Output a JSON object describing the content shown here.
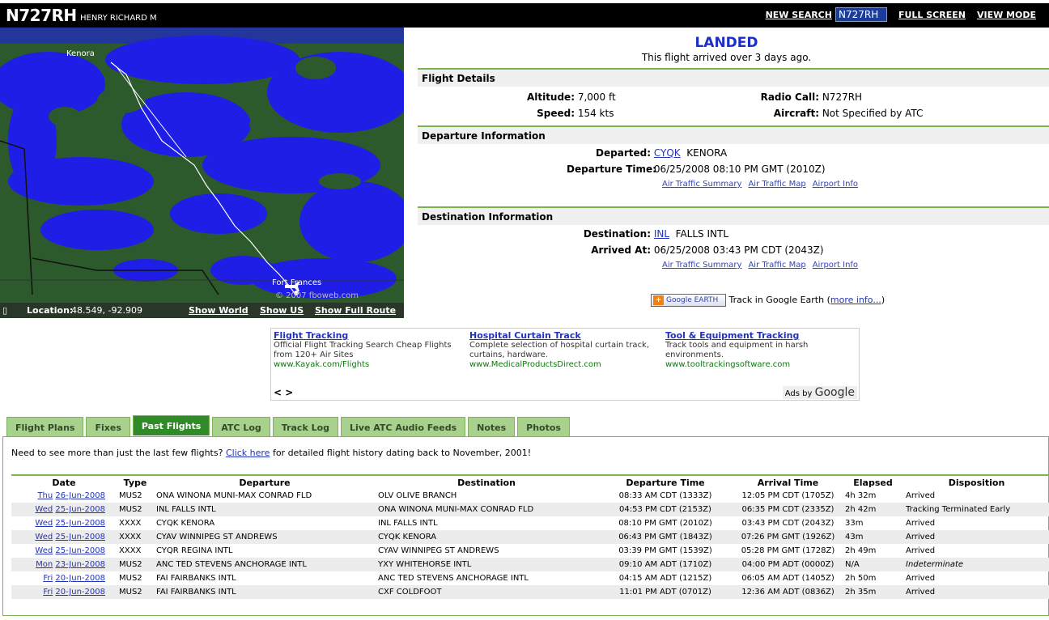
{
  "header": {
    "tail": "N727RH",
    "owner": "HENRY RICHARD M",
    "new_search": "NEW SEARCH",
    "search_value": "N727RH",
    "full_screen": "FULL SCREEN",
    "view_mode": "VIEW MODE"
  },
  "map": {
    "city_top": "Kenora",
    "city_bottom": "Fort Frances",
    "watermark": "© 2007 fboweb.com",
    "location_label": "Location:",
    "location_value": "48.549, -92.909",
    "show_world": "Show World",
    "show_us": "Show US",
    "show_route": "Show Full Route"
  },
  "status": {
    "title": "LANDED",
    "subtitle": "This flight arrived over 3 days ago."
  },
  "flight_details": {
    "heading": "Flight Details",
    "altitude_label": "Altitude:",
    "altitude": "7,000 ft",
    "speed_label": "Speed:",
    "speed": "154 kts",
    "radio_label": "Radio Call:",
    "radio": "N727RH",
    "aircraft_label": "Aircraft:",
    "aircraft": "Not Specified by ATC"
  },
  "departure": {
    "heading": "Departure Information",
    "departed_label": "Departed:",
    "code": "CYQK",
    "name": "KENORA",
    "time_label": "Departure Time:",
    "time": "06/25/2008 08:10 PM GMT (2010Z)"
  },
  "destination": {
    "heading": "Destination Information",
    "dest_label": "Destination:",
    "code": "INL",
    "name": "FALLS INTL",
    "arrived_label": "Arrived At:",
    "time": "06/25/2008 03:43 PM CDT (2043Z)"
  },
  "links": {
    "summary": "Air Traffic Summary",
    "map": "Air Traffic Map",
    "airport": "Airport Info"
  },
  "google_earth": {
    "button": "Google EARTH",
    "text": "Track in Google Earth (",
    "more": "more info...",
    "close": ")"
  },
  "ads": {
    "items": [
      {
        "title": "Flight Tracking",
        "desc": "Official Flight Tracking Search Cheap Flights from 120+ Air Sites",
        "url": "www.Kayak.com/Flights"
      },
      {
        "title": "Hospital Curtain Track",
        "desc": "Complete selection of hospital curtain track, curtains, hardware.",
        "url": "www.MedicalProductsDirect.com"
      },
      {
        "title": "Tool & Equipment Tracking",
        "desc": "Track tools and equipment in harsh environments.",
        "url": "www.tooltrackingsoftware.com"
      }
    ],
    "nav": "< >",
    "ads_by": "Ads by",
    "google": "Google"
  },
  "tabs": [
    "Flight Plans",
    "Fixes",
    "Past Flights",
    "ATC Log",
    "Track Log",
    "Live ATC Audio Feeds",
    "Notes",
    "Photos"
  ],
  "note": {
    "pre": "Need to see more than just the last few flights?",
    "link": "Click here",
    "post": "for detailed flight history dating back to November, 2001!"
  },
  "table": {
    "headers": [
      "Date",
      "Type",
      "Departure",
      "Destination",
      "Departure Time",
      "Arrival Time",
      "Elapsed",
      "Disposition"
    ],
    "rows": [
      [
        "Thu",
        "26-Jun-2008",
        "MUS2",
        "ONA  WINONA MUNI-MAX CONRAD FLD",
        "OLV  OLIVE BRANCH",
        "08:33 AM CDT (1333Z)",
        "12:05 PM CDT (1705Z)",
        "4h 32m",
        "Arrived"
      ],
      [
        "Wed",
        "25-Jun-2008",
        "MUS2",
        "INL  FALLS INTL",
        "ONA  WINONA MUNI-MAX CONRAD FLD",
        "04:53 PM CDT (2153Z)",
        "06:35 PM CDT (2335Z)",
        "2h 42m",
        "Tracking Terminated Early"
      ],
      [
        "Wed",
        "25-Jun-2008",
        "XXXX",
        "CYQK  KENORA",
        "INL  FALLS INTL",
        "08:10 PM GMT (2010Z)",
        "03:43 PM CDT (2043Z)",
        "33m",
        "Arrived"
      ],
      [
        "Wed",
        "25-Jun-2008",
        "XXXX",
        "CYAV  WINNIPEG ST ANDREWS",
        "CYQK  KENORA",
        "06:43 PM GMT (1843Z)",
        "07:26 PM GMT (1926Z)",
        "43m",
        "Arrived"
      ],
      [
        "Wed",
        "25-Jun-2008",
        "XXXX",
        "CYQR  REGINA INTL",
        "CYAV  WINNIPEG ST ANDREWS",
        "03:39 PM GMT (1539Z)",
        "05:28 PM GMT (1728Z)",
        "2h 49m",
        "Arrived"
      ],
      [
        "Mon",
        "23-Jun-2008",
        "MUS2",
        "ANC  TED STEVENS ANCHORAGE INTL",
        "YXY  WHITEHORSE INTL",
        "09:10 AM ADT (1710Z)",
        "04:00 PM ADT (0000Z)",
        "N/A",
        "Indeterminate"
      ],
      [
        "Fri",
        "20-Jun-2008",
        "MUS2",
        "FAI  FAIRBANKS INTL",
        "ANC  TED STEVENS ANCHORAGE INTL",
        "04:15 AM ADT (1215Z)",
        "06:05 AM ADT (1405Z)",
        "2h 50m",
        "Arrived"
      ],
      [
        "Fri",
        "20-Jun-2008",
        "MUS2",
        "FAI  FAIRBANKS INTL",
        "CXF  COLDFOOT",
        "11:01 PM ADT (0701Z)",
        "12:36 AM ADT (0836Z)",
        "2h 35m",
        "Arrived"
      ]
    ]
  },
  "colors": {
    "header_bg": "#000000",
    "accent_green": "#79b54a",
    "tab_active": "#2f8a27",
    "landed_blue": "#1c2ec8",
    "map_water": "#1e1ee6",
    "map_land": "#2c5a2c"
  }
}
